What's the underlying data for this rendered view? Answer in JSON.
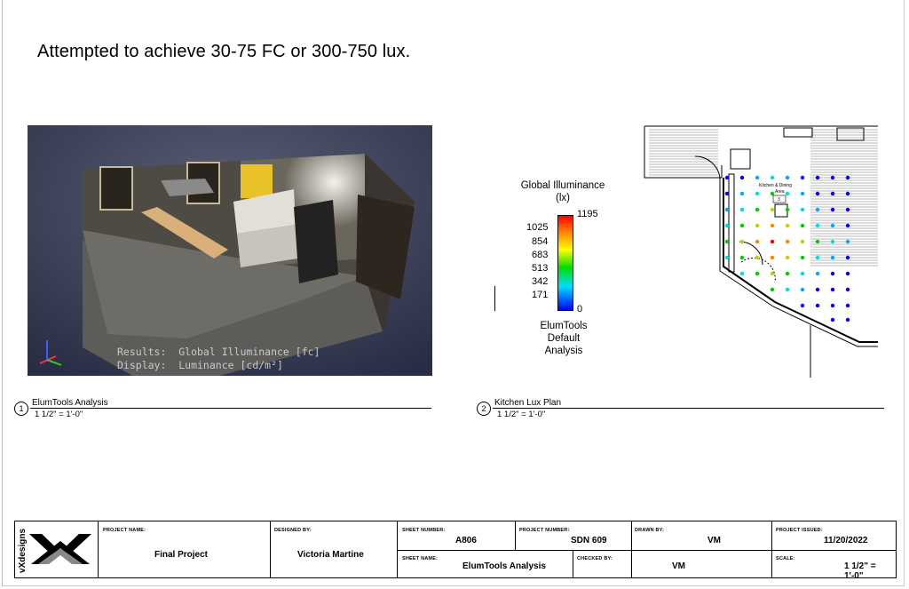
{
  "headline": "Attempted to achieve 30-75 FC or 300-750 lux.",
  "render": {
    "results_line": "Results:  Global Illuminance [fc]",
    "display_line": "Display:  Luminance [cd/m²]"
  },
  "legend": {
    "title_line1": "Global Illuminance",
    "title_line2": "(lx)",
    "max": "1195",
    "ticks": [
      "1025",
      "854",
      "683",
      "513",
      "342",
      "171"
    ],
    "min": "0",
    "footer_line1": "ElumTools",
    "footer_line2": "Default",
    "footer_line3": "Analysis"
  },
  "plan": {
    "room_label": "Kitchen & Dining",
    "room_sub": "Area",
    "room_num": "3"
  },
  "views": [
    {
      "number": "1",
      "title": "ElumTools Analysis",
      "scale": "1 1/2\" = 1'-0\""
    },
    {
      "number": "2",
      "title": "Kitchen Lux Plan",
      "scale": "1 1/2\" = 1'-0\""
    }
  ],
  "titleblock": {
    "logo": "vXdesigns",
    "project_name_label": "PROJECT NAME:",
    "project_name": "Final Project",
    "designed_by_label": "DESIGNED BY:",
    "designed_by": "Victoria Martine",
    "sheet_number_label": "SHEET NUMBER:",
    "sheet_number": "A806",
    "project_number_label": "PROJECT NUMBER:",
    "project_number": "SDN 609",
    "drawn_by_label": "DRAWN BY:",
    "drawn_by": "VM",
    "project_issued_label": "PROJECT ISSUED:",
    "project_issued": "11/20/2022",
    "sheet_name_label": "SHEET NAME:",
    "sheet_name": "ElumTools Analysis",
    "checked_by_label": "CHECKED BY:",
    "checked_by": "VM",
    "scale_label": "SCALE:",
    "scale": "1 1/2\" = 1'-0\""
  }
}
